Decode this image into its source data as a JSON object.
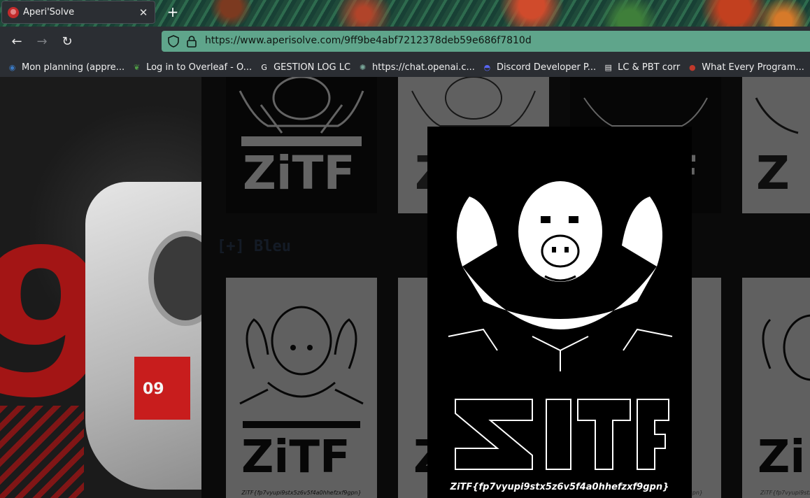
{
  "browser": {
    "tab": {
      "title": "Aperi'Solve",
      "close_glyph": "✕"
    },
    "new_tab_glyph": "+",
    "nav": {
      "back": "←",
      "forward": "→",
      "reload": "↻"
    },
    "url": "https://www.aperisolve.com/9ff9be4abf7212378deb59e686f7810d",
    "accent": "#5fa58b",
    "bookmarks": [
      {
        "label": "Mon planning (appre...",
        "icon": "globe-icon",
        "color": "#3a78c2"
      },
      {
        "label": "Log in to Overleaf - O...",
        "icon": "overleaf-icon",
        "color": "#4f9c45"
      },
      {
        "label": "GESTION LOG LC",
        "icon": "google-icon",
        "color": "#ffffff"
      },
      {
        "label": "https://chat.openai.c...",
        "icon": "openai-icon",
        "color": "#7aa89a"
      },
      {
        "label": "Discord Developer P...",
        "icon": "discord-icon",
        "color": "#5865f2"
      },
      {
        "label": "LC & PBT corr",
        "icon": "document-icon",
        "color": "#e8e8e8"
      },
      {
        "label": "What Every Program...",
        "icon": "apple-icon",
        "color": "#c0392b"
      }
    ]
  },
  "page": {
    "section_title": "[+] Bleu",
    "flag_text": "ZiTF{fp7vyupi9stx5z6v5f4a0hhefzxf9gpn}",
    "tile_flag_text": "ZiTF{fp7vyupi9stx5z6v5f4a0hhefzxf9gpn}",
    "tile_flag_fragment": "gpn}",
    "art_tag": "09",
    "big_number": "9"
  }
}
